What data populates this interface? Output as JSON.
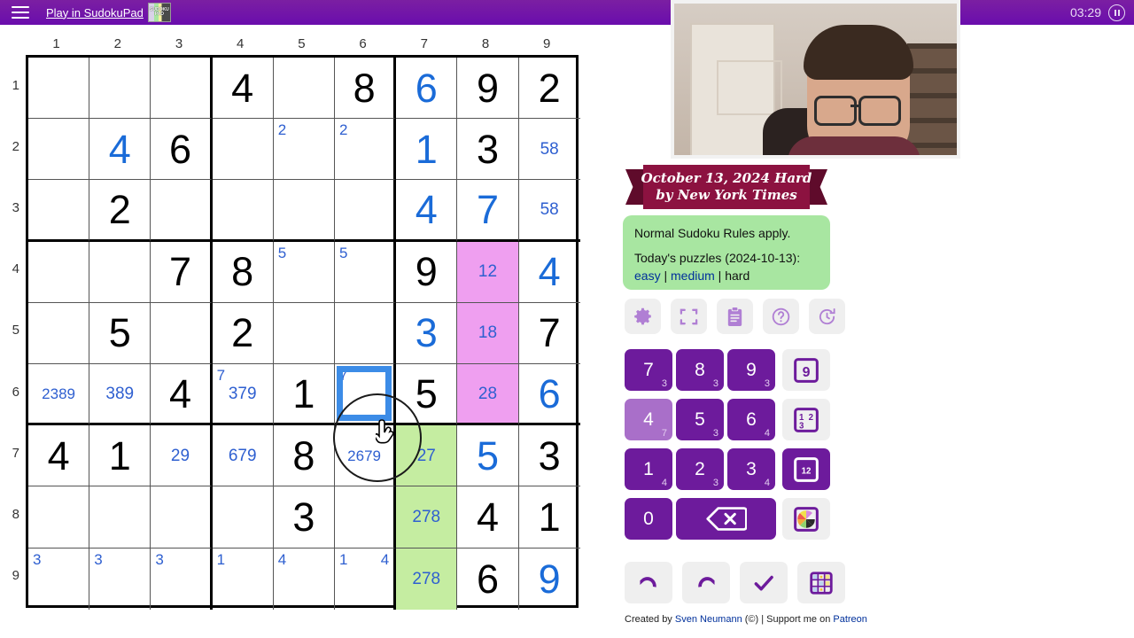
{
  "topbar": {
    "menu_icon": "hamburger-icon",
    "play_link": "Play in SudokuPad",
    "logo_text": "SUDOKU PAD",
    "timer": "03:29",
    "pause_icon": "pause-icon"
  },
  "board": {
    "col_labels": [
      "1",
      "2",
      "3",
      "4",
      "5",
      "6",
      "7",
      "8",
      "9"
    ],
    "row_labels": [
      "1",
      "2",
      "3",
      "4",
      "5",
      "6",
      "7",
      "8",
      "9"
    ],
    "selected_cell": "r6c6",
    "cells": [
      [
        {},
        {},
        {},
        {
          "given": "4"
        },
        {},
        {
          "given": "8"
        },
        {
          "user": "6"
        },
        {
          "given": "9"
        },
        {
          "given": "2"
        }
      ],
      [
        {},
        {
          "user": "4"
        },
        {
          "given": "6"
        },
        {},
        {
          "corner": [
            "2"
          ]
        },
        {
          "corner": [
            "2"
          ]
        },
        {
          "user": "1"
        },
        {
          "given": "3"
        },
        {
          "centre": "58"
        }
      ],
      [
        {},
        {
          "given": "2"
        },
        {},
        {},
        {},
        {},
        {
          "user": "4"
        },
        {
          "user": "7"
        },
        {
          "centre": "58"
        }
      ],
      [
        {},
        {},
        {
          "given": "7"
        },
        {
          "given": "8"
        },
        {
          "corner": [
            "5"
          ]
        },
        {
          "corner": [
            "5"
          ]
        },
        {
          "given": "9"
        },
        {
          "centre": "12",
          "bg": "#ef9ff0"
        },
        {
          "user": "4"
        }
      ],
      [
        {},
        {
          "given": "5"
        },
        {},
        {
          "given": "2"
        },
        {},
        {},
        {
          "user": "3"
        },
        {
          "centre": "18",
          "bg": "#ef9ff0"
        },
        {
          "given": "7"
        }
      ],
      [
        {
          "centre": "2389"
        },
        {
          "centre": "389"
        },
        {
          "given": "4"
        },
        {
          "corner": [
            "7"
          ],
          "centre": "379"
        },
        {
          "given": "1"
        },
        {
          "corner": [
            "7"
          ],
          "selected": true
        },
        {
          "given": "5"
        },
        {
          "centre": "28",
          "bg": "#ef9ff0"
        },
        {
          "user": "6"
        }
      ],
      [
        {
          "given": "4"
        },
        {
          "given": "1"
        },
        {
          "centre": "29"
        },
        {
          "centre": "679"
        },
        {
          "given": "8"
        },
        {
          "centre": "2679"
        },
        {
          "centre": "27",
          "bg": "#c5eda1"
        },
        {
          "user": "5"
        },
        {
          "given": "3"
        }
      ],
      [
        {},
        {},
        {},
        {},
        {
          "given": "3"
        },
        {},
        {
          "centre": "278",
          "bg": "#c5eda1"
        },
        {
          "given": "4"
        },
        {
          "given": "1"
        }
      ],
      [
        {
          "corner": [
            "3"
          ]
        },
        {
          "corner": [
            "3"
          ]
        },
        {
          "corner": [
            "3"
          ]
        },
        {
          "corner": [
            "1"
          ]
        },
        {
          "corner": [
            "4"
          ]
        },
        {
          "corner": [
            "1",
            "4"
          ]
        },
        {
          "centre": "278",
          "bg": "#c5eda1"
        },
        {
          "given": "6"
        },
        {
          "user": "9"
        }
      ]
    ]
  },
  "panel": {
    "title_line1": "October 13, 2024 Hard",
    "title_line2": "by New York Times",
    "rules_text": "Normal Sudoku Rules apply.",
    "puzzles_label": "Today's puzzles (2024-10-13):",
    "link_easy": "easy",
    "sep1": " | ",
    "link_medium": "medium",
    "sep2": " | ",
    "current_difficulty": "hard",
    "tools": [
      {
        "name": "settings-icon",
        "label": "Settings"
      },
      {
        "name": "fullscreen-icon",
        "label": "Fullscreen"
      },
      {
        "name": "rules-icon",
        "label": "Rules"
      },
      {
        "name": "help-icon",
        "label": "Help"
      },
      {
        "name": "restart-icon",
        "label": "Restart"
      }
    ],
    "keypad": {
      "keys": [
        {
          "digit": "7",
          "count": "3",
          "faded": false
        },
        {
          "digit": "8",
          "count": "3",
          "faded": false
        },
        {
          "digit": "9",
          "count": "3",
          "faded": false
        },
        {
          "digit": "4",
          "count": "7",
          "faded": true
        },
        {
          "digit": "5",
          "count": "3",
          "faded": false
        },
        {
          "digit": "6",
          "count": "4",
          "faded": false
        },
        {
          "digit": "1",
          "count": "4",
          "faded": false
        },
        {
          "digit": "2",
          "count": "3",
          "faded": false
        },
        {
          "digit": "3",
          "count": "4",
          "faded": false
        },
        {
          "digit": "0",
          "count": "",
          "faded": false
        }
      ],
      "delete_icon": "delete-icon",
      "modes": [
        {
          "name": "mode-normal",
          "glyph": "9",
          "active": false
        },
        {
          "name": "mode-corner",
          "glyph": "123",
          "active": false
        },
        {
          "name": "mode-centre",
          "glyph": "12",
          "active": true
        },
        {
          "name": "mode-colour",
          "glyph": "palette",
          "active": false
        }
      ]
    },
    "bottom_buttons": [
      {
        "name": "undo-button",
        "icon": "undo-icon"
      },
      {
        "name": "redo-button",
        "icon": "redo-icon"
      },
      {
        "name": "check-button",
        "icon": "check-icon"
      },
      {
        "name": "grid-button",
        "icon": "grid-icon"
      }
    ],
    "credit_prefix": "Created by ",
    "credit_author": "Sven Neumann",
    "credit_middle": " (©) | Support me on ",
    "credit_patreon": "Patreon"
  },
  "colors": {
    "brand_purple": "#6d1b9c",
    "topbar_purple": "#6a0dad",
    "user_digit_blue": "#1a6bd8",
    "pencil_blue": "#2e5fd0",
    "highlight_pink": "#ef9ff0",
    "highlight_green": "#c5eda1",
    "rules_green": "#a8e6a1",
    "ribbon_maroon": "#8c1240",
    "selection_blue": "#3c8ce7"
  }
}
